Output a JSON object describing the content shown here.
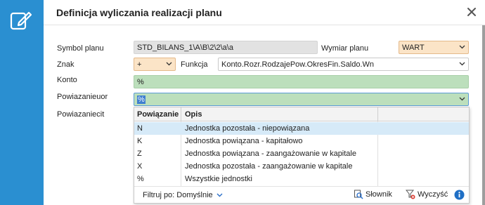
{
  "dialog": {
    "title": "Definicja wyliczania realizacji planu"
  },
  "form": {
    "symbol_label": "Symbol planu",
    "symbol_value": "STD_BILANS_1\\A\\B\\2\\2\\a\\a",
    "wymiar_label": "Wymiar planu",
    "wymiar_value": "WART",
    "znak_label": "Znak",
    "znak_value": "+",
    "funkcja_label": "Funkcja",
    "funkcja_value": "Konto.Rozr.RodzajePow.OkresFin.Saldo.Wn",
    "konto_label": "Konto",
    "konto_value": "%",
    "powiazanieuor_label": "Powiazanieuor",
    "powiazanieuor_value": "%",
    "powiazaniecit_label": "Powiazaniecit"
  },
  "dropdown": {
    "headers": {
      "col1": "Powiązanie",
      "col2": "Opis"
    },
    "rows": [
      {
        "code": "N",
        "desc": "Jednostka pozostała - niepowiązana"
      },
      {
        "code": "K",
        "desc": "Jednostka powiązana - kapitałowo"
      },
      {
        "code": "Z",
        "desc": "Jednostka powiązana - zaangażowanie w kapitale"
      },
      {
        "code": "X",
        "desc": "Jednostka pozostała - zaangażowanie w kapitale"
      },
      {
        "code": "%",
        "desc": "Wszystkie jednostki"
      }
    ],
    "footer": {
      "filter_label": "Filtruj po: Domyślnie",
      "slownik_label": "Słownik",
      "wyczysc_label": "Wyczyść"
    }
  },
  "colors": {
    "accent": "#2a8fd1",
    "field_orange": "#fbe4c7",
    "field_green": "#bcdfbc",
    "field_grey": "#e2e2e2",
    "row_selected": "#d6eaf8"
  },
  "icons": {
    "app": "edit-document-icon",
    "close": "close-icon",
    "chevron": "chevron-down-icon",
    "slownik": "search-document-icon",
    "wyczysc": "clear-filter-icon",
    "info": "info-icon"
  }
}
